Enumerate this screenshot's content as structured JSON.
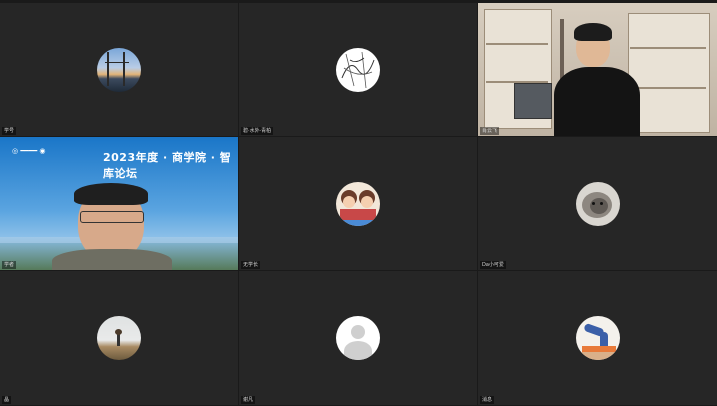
{
  "participants": [
    {
      "name": "学号",
      "type": "avatar",
      "avatar": "sunset-landscape-photo"
    },
    {
      "name": "碧·水外·青柏",
      "type": "avatar",
      "avatar": "line-sketch-photo"
    },
    {
      "name": "肖云飞",
      "type": "video",
      "scene": "bookshelf-room"
    },
    {
      "name": "学者",
      "type": "video",
      "scene": "presentation-slide",
      "slide": {
        "title": "2023年度 · 商学院 · 智库论坛"
      }
    },
    {
      "name": "无学长",
      "type": "avatar",
      "avatar": "cartoon-couple-photo"
    },
    {
      "name": "Da小可爱",
      "type": "avatar",
      "avatar": "kitten-photo"
    },
    {
      "name": "晶",
      "type": "avatar",
      "avatar": "landscape-person-photo"
    },
    {
      "name": "谢凡",
      "type": "avatar",
      "avatar": "default-user-icon"
    },
    {
      "name": "消息",
      "type": "avatar",
      "avatar": "gymnast-photo"
    }
  ]
}
